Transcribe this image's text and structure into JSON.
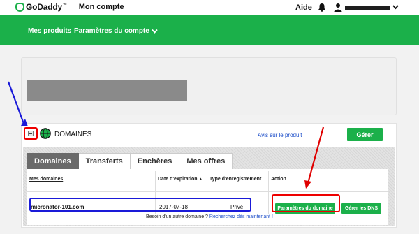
{
  "topbar": {
    "logo_text": "GoDaddy",
    "logo_tm": "™",
    "account_title": "Mon compte",
    "help_label": "Aide",
    "icons": [
      "bell-icon",
      "user-icon",
      "chevron-down-icon"
    ]
  },
  "nav": {
    "products_label": "Mes produits",
    "settings_label": "Paramètres du compte"
  },
  "domains": {
    "title": "DOMAINES",
    "feedback_label": "Avis sur le produit",
    "manage_label": "Gérer",
    "tabs": [
      {
        "label": "Domaines",
        "active": true
      },
      {
        "label": "Transferts",
        "active": false
      },
      {
        "label": "Enchères",
        "active": false
      },
      {
        "label": "Mes offres",
        "active": false
      }
    ],
    "columns": {
      "domains": "Mes domaines",
      "expiration": "Date d'expiration",
      "sort_indicator": "▲",
      "registration": "Type d'enregistrement",
      "action": "Action"
    },
    "rows": [
      {
        "domain": "micronator-101.com",
        "expiration": "2017-07-18",
        "registration": "Privé",
        "settings_button": "Paramètres du domaine",
        "dns_button": "Gérer les DNS"
      }
    ],
    "footer_text": "Besoin d'un autre domaine ?",
    "footer_link": "Recherchez dès maintenant !"
  },
  "colors": {
    "brand_green": "#1bb04a",
    "annotation_red": "#e00000",
    "annotation_blue": "#1a1ad8",
    "link_blue": "#1a4cc8"
  }
}
